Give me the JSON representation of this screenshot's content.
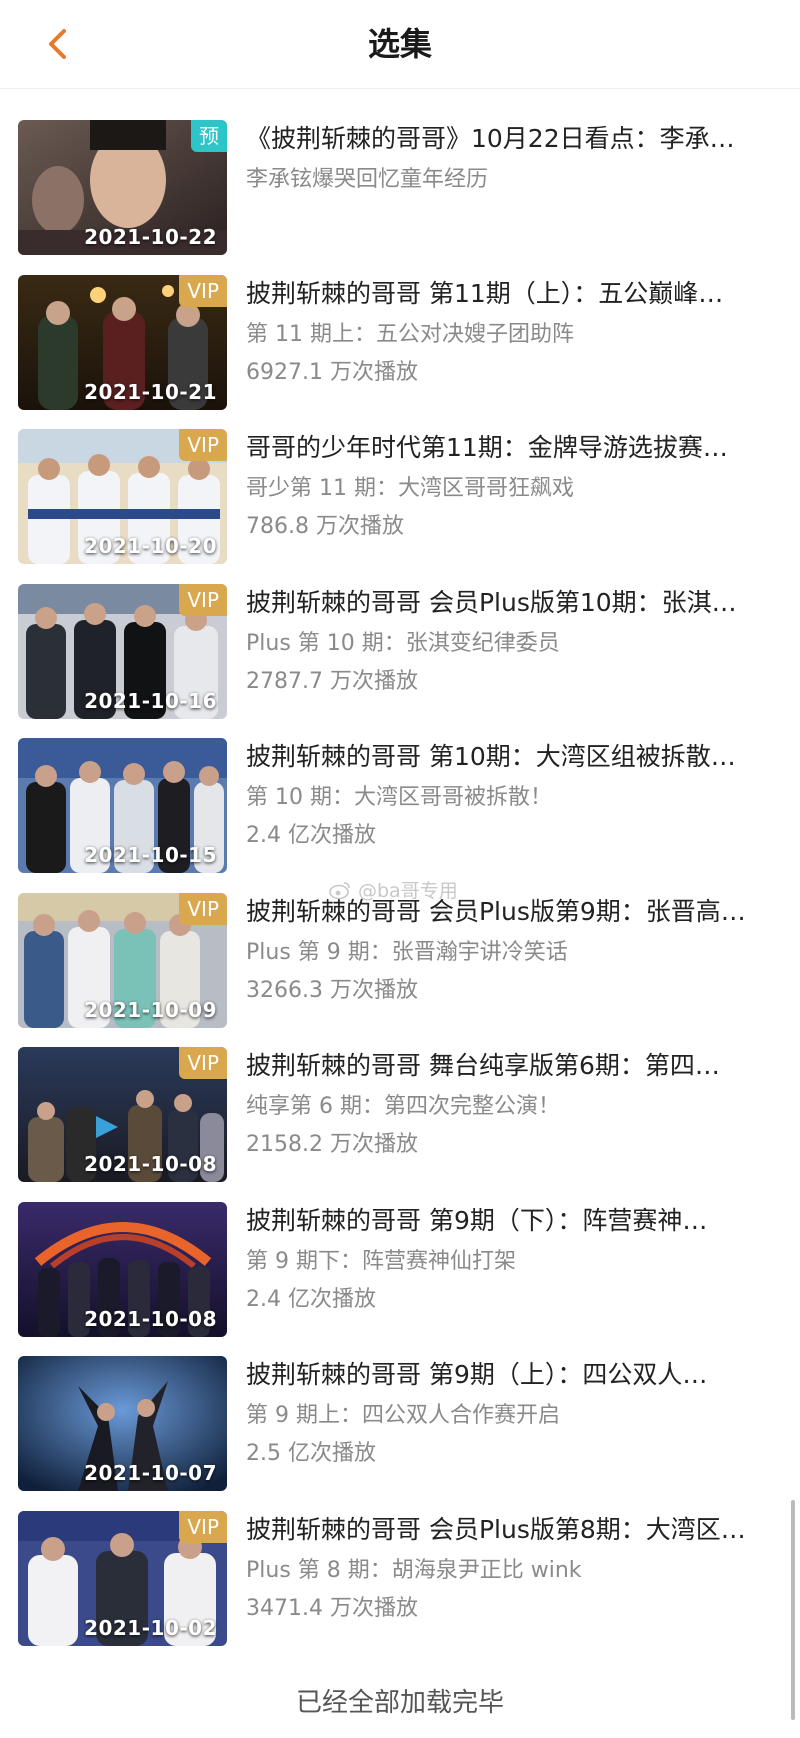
{
  "header": {
    "title": "选集",
    "back_icon": "chevron-left-icon",
    "accent_color": "#e8792a"
  },
  "episodes": [
    {
      "title": "《披荆斩棘的哥哥》10月22日看点：李承…",
      "subtitle": "李承铉爆哭回忆童年经历",
      "plays": "",
      "date": "2021-10-22",
      "badge": "预",
      "badge_type": "preview"
    },
    {
      "title": "披荆斩棘的哥哥 第11期（上）：五公巅峰…",
      "subtitle": "第 11 期上：五公对决嫂子团助阵",
      "plays": "6927.1 万次播放",
      "date": "2021-10-21",
      "badge": "VIP",
      "badge_type": "vip"
    },
    {
      "title": "哥哥的少年时代第11期：金牌导游选拔赛…",
      "subtitle": "哥少第 11 期：大湾区哥哥狂飙戏",
      "plays": "786.8 万次播放",
      "date": "2021-10-20",
      "badge": "VIP",
      "badge_type": "vip"
    },
    {
      "title": "披荆斩棘的哥哥 会员Plus版第10期：张淇…",
      "subtitle": "Plus 第 10 期：张淇变纪律委员",
      "plays": "2787.7 万次播放",
      "date": "2021-10-16",
      "badge": "VIP",
      "badge_type": "vip"
    },
    {
      "title": "披荆斩棘的哥哥 第10期：大湾区组被拆散…",
      "subtitle": "第 10 期：大湾区哥哥被拆散！",
      "plays": "2.4 亿次播放",
      "date": "2021-10-15",
      "badge": "",
      "badge_type": "none"
    },
    {
      "title": "披荆斩棘的哥哥 会员Plus版第9期：张晋高…",
      "subtitle": "Plus 第 9 期：张晋瀚宇讲冷笑话",
      "plays": "3266.3 万次播放",
      "date": "2021-10-09",
      "badge": "VIP",
      "badge_type": "vip"
    },
    {
      "title": "披荆斩棘的哥哥 舞台纯享版第6期：第四…",
      "subtitle": "纯享第 6 期：第四次完整公演！",
      "plays": "2158.2 万次播放",
      "date": "2021-10-08",
      "badge": "VIP",
      "badge_type": "vip"
    },
    {
      "title": "披荆斩棘的哥哥 第9期（下）：阵营赛神…",
      "subtitle": "第 9 期下：阵营赛神仙打架",
      "plays": "2.4 亿次播放",
      "date": "2021-10-08",
      "badge": "",
      "badge_type": "none"
    },
    {
      "title": "披荆斩棘的哥哥 第9期（上）：四公双人…",
      "subtitle": "第 9 期上：四公双人合作赛开启",
      "plays": "2.5 亿次播放",
      "date": "2021-10-07",
      "badge": "",
      "badge_type": "none"
    },
    {
      "title": "披荆斩棘的哥哥 会员Plus版第8期：大湾区…",
      "subtitle": "Plus 第 8 期：胡海泉尹正比 wink",
      "plays": "3471.4 万次播放",
      "date": "2021-10-02",
      "badge": "VIP",
      "badge_type": "vip"
    }
  ],
  "watermark": "@ba哥专用",
  "footer": {
    "end_text": "已经全部加载完毕"
  }
}
